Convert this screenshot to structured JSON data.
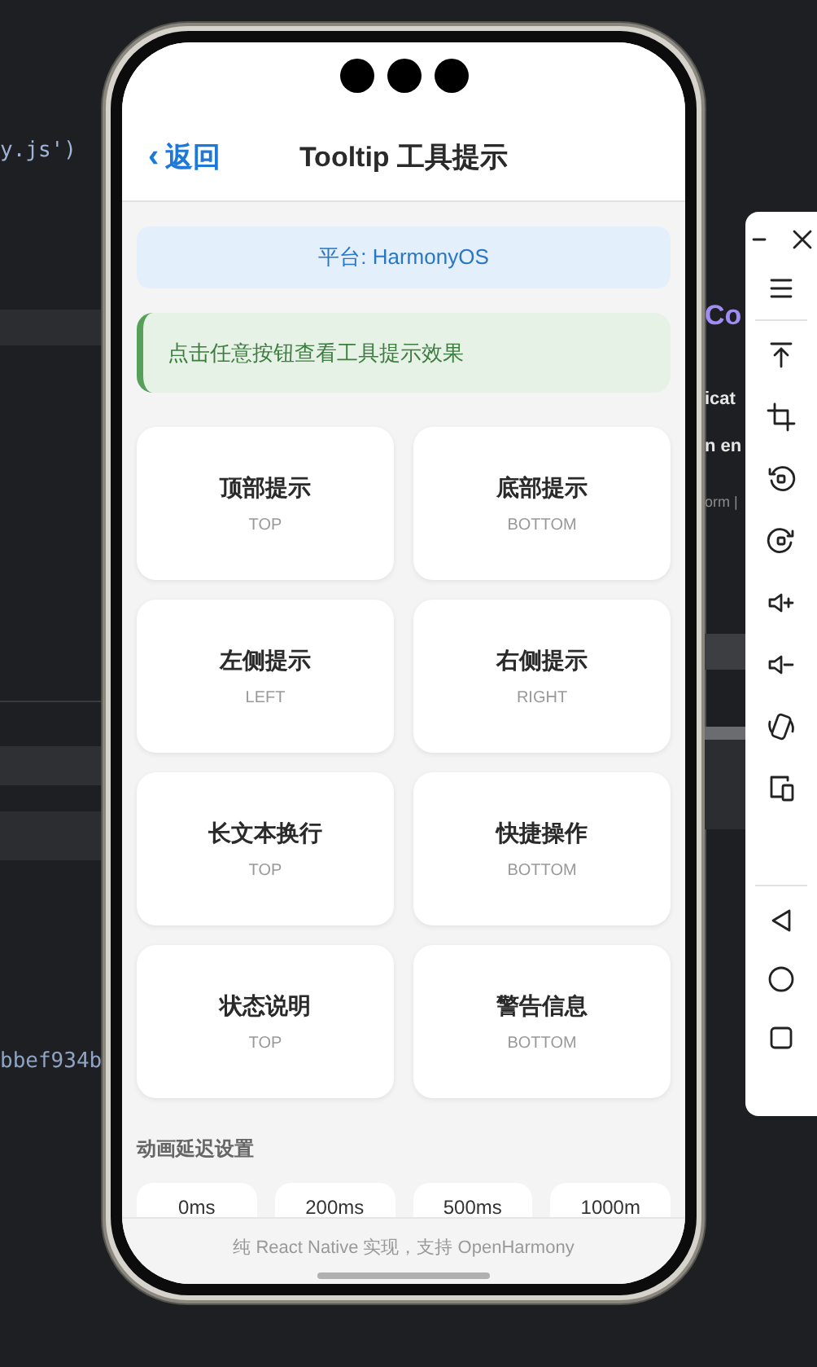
{
  "editor_left": [
    {
      "text": "y.js')"
    },
    {
      "text": "bbef934b"
    }
  ],
  "editor_right": [
    {
      "text": "Co",
      "kind": "heading"
    },
    {
      "text": "icat",
      "kind": "strong"
    },
    {
      "text": "n en",
      "kind": "strong"
    },
    {
      "text": "orm |",
      "kind": "muted"
    }
  ],
  "phone": {
    "header": {
      "back": "返回",
      "back_chevron": "‹",
      "title": "Tooltip 工具提示"
    },
    "platform": "平台: HarmonyOS",
    "hint": "点击任意按钮查看工具提示效果",
    "tooltip_buttons": [
      {
        "label": "顶部提示",
        "position": "TOP"
      },
      {
        "label": "底部提示",
        "position": "BOTTOM"
      },
      {
        "label": "左侧提示",
        "position": "LEFT"
      },
      {
        "label": "右侧提示",
        "position": "RIGHT"
      },
      {
        "label": "长文本换行",
        "position": "TOP"
      },
      {
        "label": "快捷操作",
        "position": "BOTTOM"
      },
      {
        "label": "状态说明",
        "position": "TOP"
      },
      {
        "label": "警告信息",
        "position": "BOTTOM"
      }
    ],
    "delay_title": "动画延迟设置",
    "delays": [
      "0ms",
      "200ms",
      "500ms",
      "1000m"
    ],
    "footer": "纯 React Native 实现，支持 OpenHarmony"
  }
}
